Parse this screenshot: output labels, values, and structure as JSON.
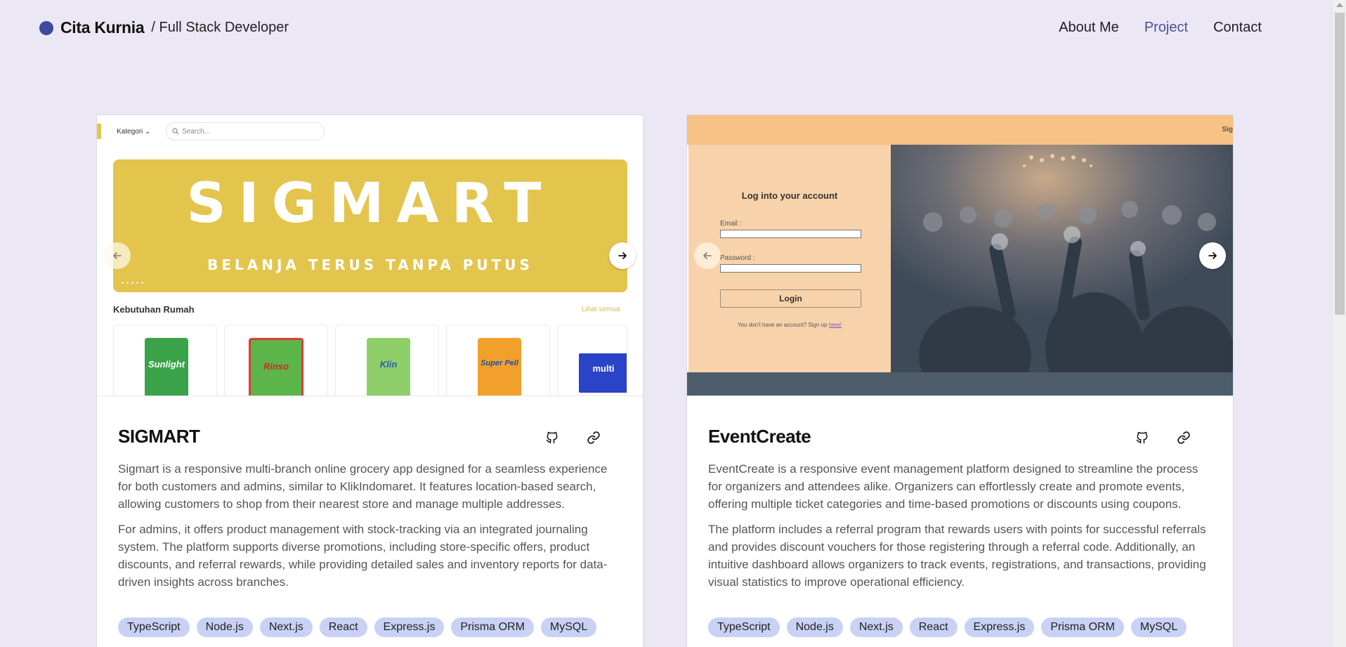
{
  "header": {
    "brand_name": "Cita Kurnia",
    "brand_role": "/ Full Stack Developer",
    "nav": [
      {
        "label": "About Me",
        "active": false
      },
      {
        "label": "Project",
        "active": true
      },
      {
        "label": "Contact",
        "active": false
      }
    ]
  },
  "colors": {
    "background": "#ebe7f5",
    "accent": "#4a5397",
    "tag_bg": "#c9d2f5"
  },
  "projects": [
    {
      "title": "SIGMART",
      "desc1": "Sigmart is a responsive multi-branch online grocery app designed for a seamless experience for both customers and admins, similar to KlikIndomaret. It features location-based search, allowing customers to shop from their nearest store and manage multiple addresses.",
      "desc2": "For admins, it offers product management with stock-tracking via an integrated journaling system. The platform supports diverse promotions, including store-specific offers, product discounts, and referral rewards, while providing detailed sales and inventory reports for data-driven insights across branches.",
      "tags": [
        "TypeScript",
        "Node.js",
        "Next.js",
        "React",
        "Express.js",
        "Prisma ORM",
        "MySQL"
      ],
      "preview": {
        "kategori": "Kategori ⌄",
        "search_placeholder": "Search...",
        "banner_logo": "SIGMART",
        "banner_tagline": "BELANJA TERUS TANPA PUTUS",
        "section": "Kebutuhan Rumah",
        "see_all": "Lihat semua",
        "products": [
          "Sunlight",
          "Rinso",
          "Klin",
          "Super Pell",
          "multi"
        ]
      }
    },
    {
      "title": "EventCreate",
      "desc1": "EventCreate is a responsive event management platform designed to streamline the process for organizers and attendees alike. Organizers can effortlessly create and promote events, offering multiple ticket categories and time-based promotions or discounts using coupons.",
      "desc2": "The platform includes a referral program that rewards users with points for successful referrals and provides discount vouchers for those registering through a referral code. Additionally, an intuitive dashboard allows organizers to track events, registrations, and transactions, providing visual statistics to improve operational efficiency.",
      "tags": [
        "TypeScript",
        "Node.js",
        "Next.js",
        "React",
        "Express.js",
        "Prisma ORM",
        "MySQL"
      ],
      "preview": {
        "topbar_text": "Sig",
        "login_title": "Log into your account",
        "email_label": "Email :",
        "password_label": "Password :",
        "login_button": "Login",
        "signup_text": "You don't have an account? Sign up",
        "signup_link": "here!"
      }
    }
  ]
}
